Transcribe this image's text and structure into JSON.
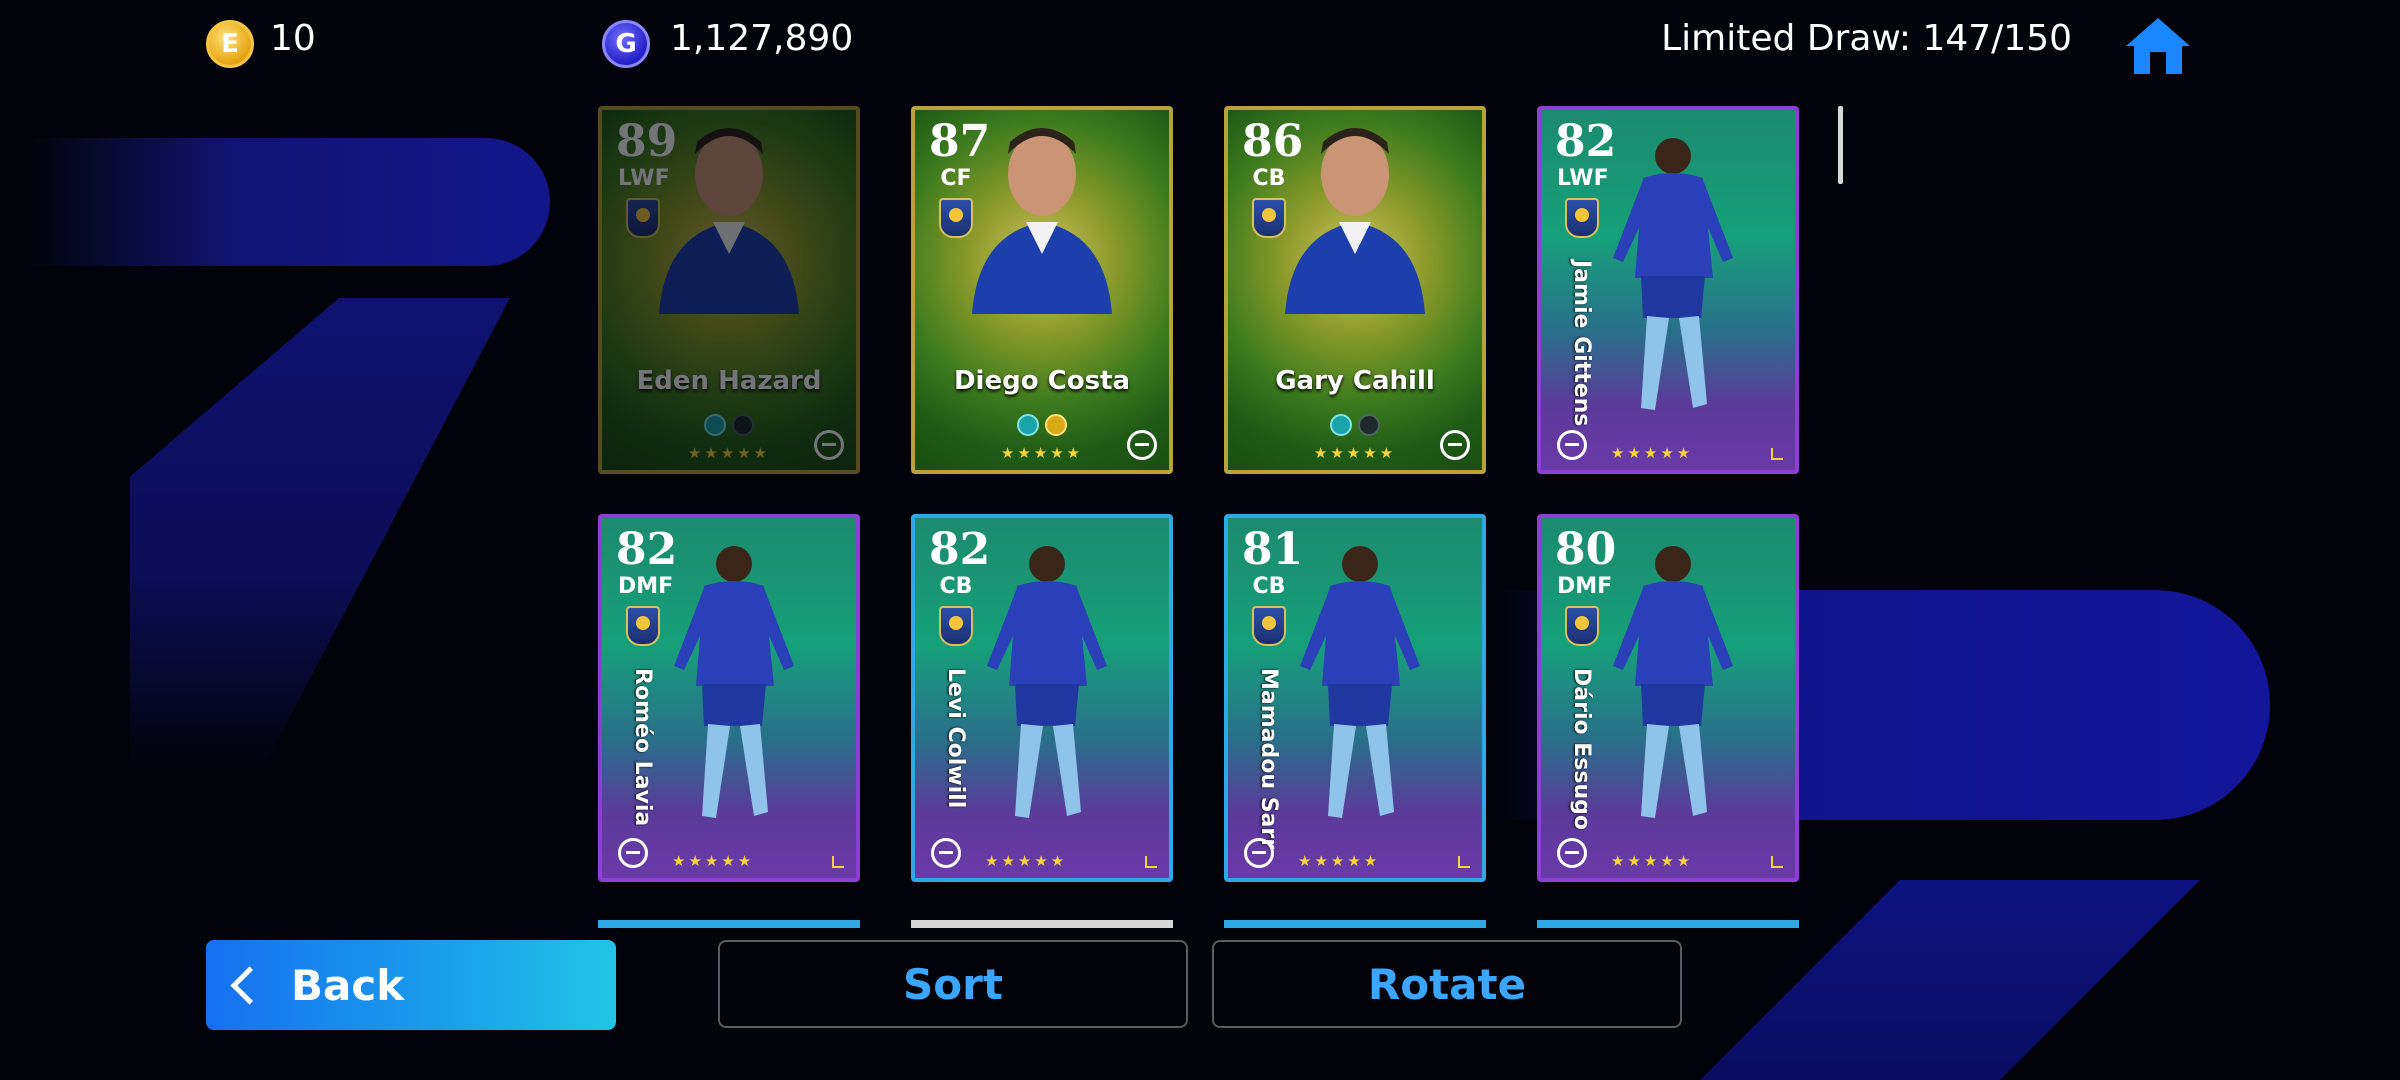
{
  "currency": {
    "ecoin_icon": "ecoin-icon",
    "ecoin_letter": "E",
    "ecoin_value": "10",
    "gp_icon": "gp-icon",
    "gp_letter": "G",
    "gp_value": "1,127,890"
  },
  "header": {
    "limited_draw": "Limited Draw: 147/150",
    "home_icon": "home-icon"
  },
  "cards": [
    {
      "rating": "89",
      "position": "LWF",
      "name": "Eden Hazard",
      "stars": "★★★★★",
      "style": "gold",
      "drawn": true
    },
    {
      "rating": "87",
      "position": "CF",
      "name": "Diego Costa",
      "stars": "★★★★★",
      "style": "gold",
      "drawn": false
    },
    {
      "rating": "86",
      "position": "CB",
      "name": "Gary Cahill",
      "stars": "★★★★★",
      "style": "gold",
      "drawn": false
    },
    {
      "rating": "82",
      "position": "LWF",
      "name": "Jamie Gittens",
      "stars": "★★★★★",
      "style": "blue",
      "drawn": false
    },
    {
      "rating": "82",
      "position": "DMF",
      "name": "Roméo Lavia",
      "stars": "★★★★★",
      "style": "blue",
      "drawn": false
    },
    {
      "rating": "82",
      "position": "CB",
      "name": "Levi Colwill",
      "stars": "★★★★★",
      "style": "blue",
      "drawn": false
    },
    {
      "rating": "81",
      "position": "CB",
      "name": "Mamadou Sarr",
      "stars": "★★★★★",
      "style": "blue",
      "drawn": false
    },
    {
      "rating": "80",
      "position": "DMF",
      "name": "Dário Essugo",
      "stars": "★★★★★",
      "style": "blue",
      "drawn": false
    }
  ],
  "buttons": {
    "back": "Back",
    "sort": "Sort",
    "rotate": "Rotate"
  },
  "colors": {
    "accent_blue": "#3aa6ff",
    "back_gradient_start": "#1670f0",
    "back_gradient_end": "#23c4e6"
  }
}
